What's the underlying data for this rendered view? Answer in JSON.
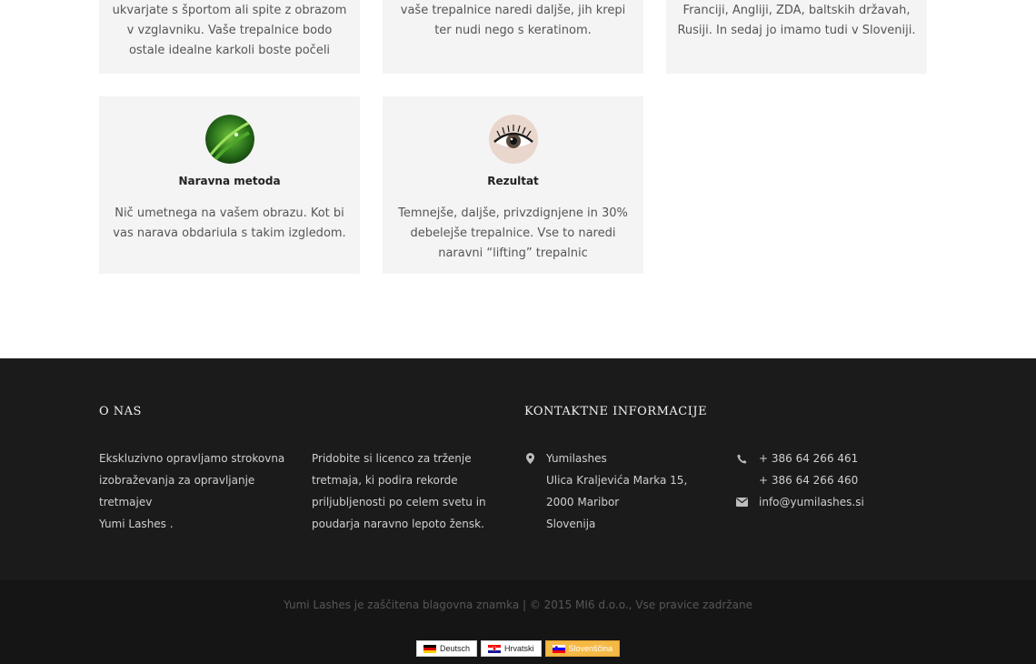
{
  "cards_top": [
    {
      "lines": [
        "ukvarjate s športom ali spite z obrazom",
        "v vzglavniku. Vaše trepalnice bodo",
        "ostale idealne karkoli boste počeli"
      ]
    },
    {
      "lines": [
        "vaše trepalnice naredi daljše, jih krepi",
        "ter nudi nego s keratinom."
      ]
    },
    {
      "lines": [
        "Franciji, Angliji, ZDA, baltskih državah,",
        "Rusiji. In sedaj jo imamo tudi v Sloveniji."
      ]
    }
  ],
  "cards_bottom": [
    {
      "title": "Naravna metoda",
      "icon": "grass-leaf-image",
      "lines": [
        "Nič umetnega na vašem obrazu. Kot bi",
        "vas narava obdariula s takim izgledom."
      ]
    },
    {
      "title": "Rezultat",
      "icon": "eye-lashes-image",
      "lines": [
        "Temnejše, daljše, privzdignjene in 30%",
        "debelejše trepalnice. Vse to naredi",
        "naravni “lifting” trepalnic"
      ]
    }
  ],
  "footer": {
    "about_title": "O NAS",
    "about_col1": [
      "Ekskluzivno opravljamo strokovna",
      "izobraževanja za opravljanje tretmajev",
      "Yumi Lashes ."
    ],
    "about_col2": [
      "Pridobite si licenco za trženje",
      "tretmaja, ki podira rekorde",
      "priljubljenosti po celem svetu in",
      "poudarja naravno lepoto žensk."
    ],
    "contact_title": "KONTAKTNE INFORMACIJE",
    "address": [
      "Yumilashes",
      "Ulica Kraljevića Marka 15,",
      "2000 Maribor",
      "Slovenija"
    ],
    "phones": [
      "+ 386 64 266 461",
      "+ 386 64 266 460"
    ],
    "email": "info@yumilashes.si",
    "icons": {
      "address": "map-marker-icon",
      "phone": "phone-icon",
      "email": "envelope-icon"
    },
    "copyright": "Yumi Lashes je zaščitena blagovna znamka | © 2015 MI6 d.o.o., Vse pravice zadržane"
  },
  "languages": [
    {
      "label": "Deutsch",
      "flag": "german-flag-icon",
      "active": false
    },
    {
      "label": "Hrvatski",
      "flag": "croatian-flag-icon",
      "active": false
    },
    {
      "label": "Slovenščina",
      "flag": "slovenian-flag-icon",
      "active": true
    }
  ],
  "colors": {
    "footer_bg": "#1b1b1b",
    "card_bg": "#f4f4f4",
    "active_lang": "#f5b945"
  }
}
